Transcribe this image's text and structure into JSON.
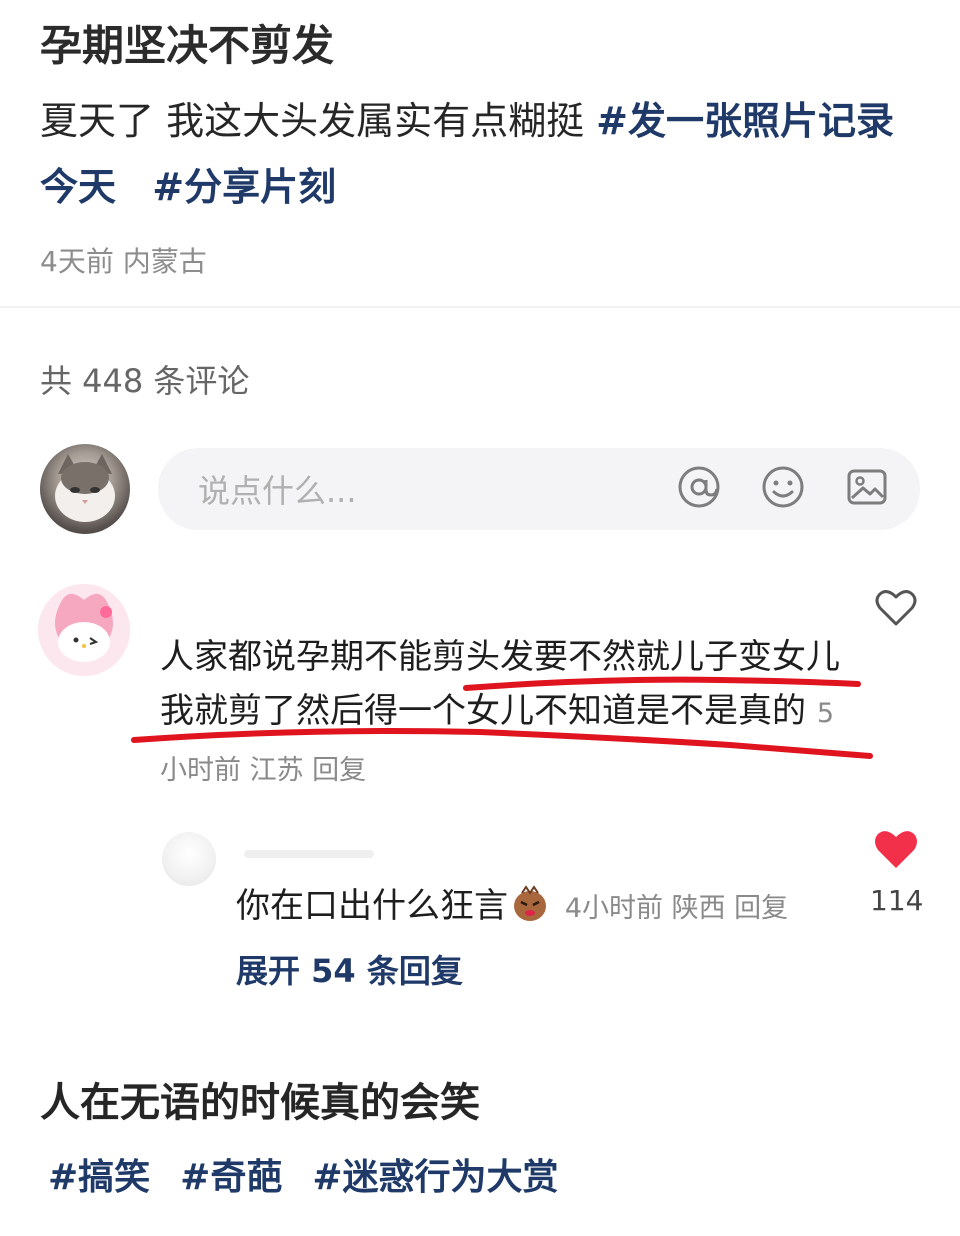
{
  "post": {
    "title": "孕期坚决不剪发",
    "body_text": "夏天了 我这大头发属实有点糊挺 ",
    "tags": [
      "#发一张照片记录今天",
      "#分享片刻"
    ],
    "meta": "4天前 内蒙古"
  },
  "comments_section": {
    "count_label": "共 448 条评论",
    "input_placeholder": "说点什么...",
    "input_icons": [
      "at-icon",
      "emoji-icon",
      "image-icon"
    ]
  },
  "comment": {
    "text": "人家都说孕期不能剪头发要不然就儿子变女儿我就剪了然后得一个女儿不知道是不是真的",
    "meta": "5小时前 江苏 回复",
    "underline_color": "#e0141e"
  },
  "reply": {
    "text": "你在口出什么狂言",
    "meta": "4小时前 陕西 回复",
    "like_count": "114",
    "expand_label": "展开 54 条回复",
    "like_color": "#f2304a"
  },
  "next_post": {
    "title": "人在无语的时候真的会笑",
    "tags": [
      "#搞笑",
      "#奇葩",
      "#迷惑行为大赏"
    ]
  },
  "colors": {
    "tag": "#1f3a68",
    "meta": "#8d8d8d",
    "input_bg": "#f4f4f6"
  }
}
